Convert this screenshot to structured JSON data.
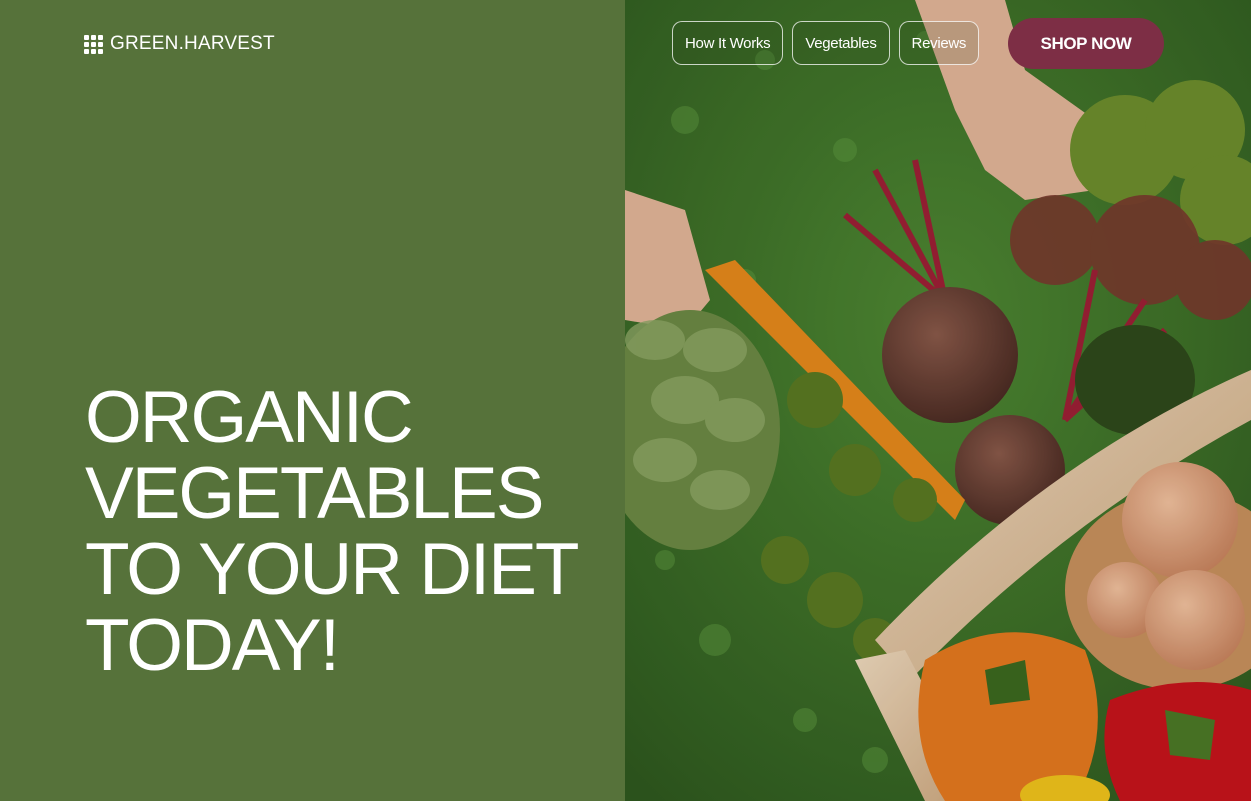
{
  "brand": {
    "name": "GREEN.HARVEST",
    "icon": "grid-icon"
  },
  "nav": {
    "items": [
      {
        "label": "How It Works"
      },
      {
        "label": "Vegetables"
      },
      {
        "label": "Reviews"
      }
    ],
    "cta_label": "SHOP NOW"
  },
  "hero": {
    "headline_lines": [
      "ORGANIC",
      "VEGETABLES",
      "TO YOUR DIET",
      "TODAY!"
    ],
    "image": "vegetable-basket-photo"
  },
  "colors": {
    "panel_green": "#56723a",
    "cta_maroon": "#7d2e45",
    "text": "#ffffff"
  }
}
